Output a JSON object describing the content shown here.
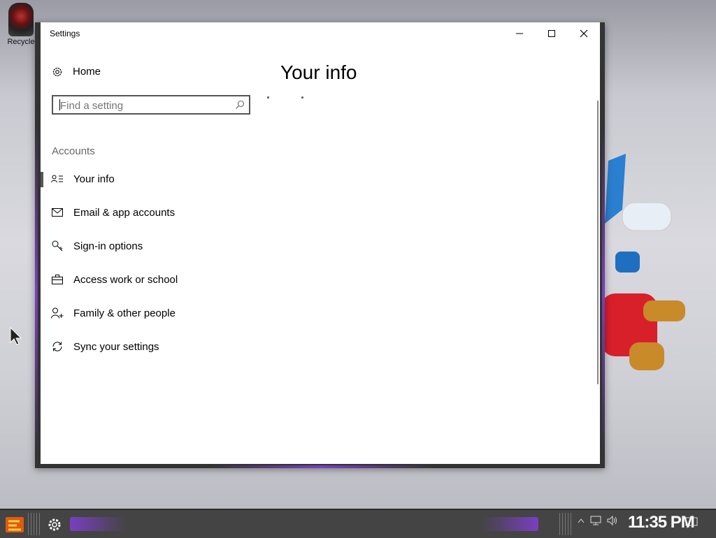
{
  "desktop": {
    "recycle_label": "Recycle"
  },
  "window": {
    "title": "Settings",
    "home_label": "Home",
    "search": {
      "placeholder": "Find a setting"
    },
    "section_title": "Accounts",
    "nav": [
      {
        "label": "Your info",
        "icon": "contact-card-icon",
        "selected": true
      },
      {
        "label": "Email & app accounts",
        "icon": "mail-icon"
      },
      {
        "label": "Sign-in options",
        "icon": "key-icon"
      },
      {
        "label": "Access work or school",
        "icon": "briefcase-icon"
      },
      {
        "label": "Family & other people",
        "icon": "add-person-icon"
      },
      {
        "label": "Sync your settings",
        "icon": "sync-icon"
      }
    ],
    "page_title": "Your info"
  },
  "taskbar": {
    "clock": "11:35 PM"
  },
  "colors": {
    "accent": "#7a3fc0",
    "window_bg": "#ffffff",
    "taskbar_bg": "#444444"
  }
}
